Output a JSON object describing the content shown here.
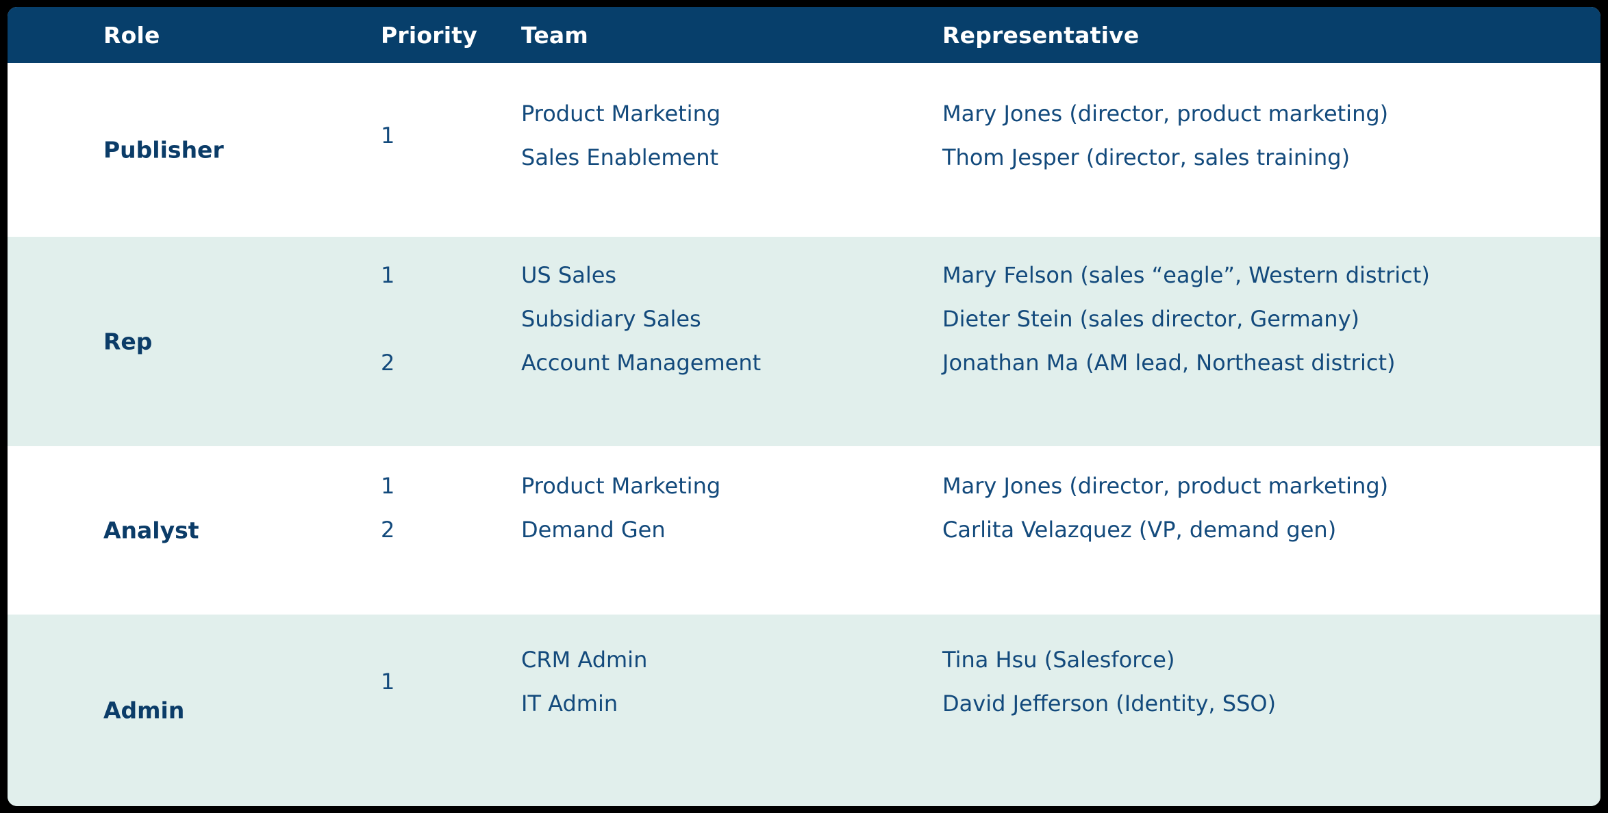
{
  "table": {
    "columns": [
      {
        "key": "role",
        "label": "Role"
      },
      {
        "key": "priority",
        "label": "Priority"
      },
      {
        "key": "team",
        "label": "Team"
      },
      {
        "key": "representative",
        "label": "Representative"
      }
    ],
    "colors": {
      "header_background": "#073f6b",
      "header_text": "#ffffff",
      "row_alt_background": "#e1efec",
      "row_plain_background": "#ffffff",
      "body_text": "#134a7c",
      "role_text": "#0b3c68",
      "page_background": "#000000"
    },
    "sections": [
      {
        "role": "Publisher",
        "shaded": false,
        "rows": [
          {
            "priority": "1",
            "team": "Product Marketing",
            "representative": "Mary Jones (director, product marketing)"
          },
          {
            "priority": "",
            "team": "Sales Enablement",
            "representative": "Thom Jesper (director, sales training)"
          }
        ]
      },
      {
        "role": "Rep",
        "shaded": true,
        "rows": [
          {
            "priority": "1",
            "team": "US Sales",
            "representative": "Mary Felson (sales “eagle”, Western district)"
          },
          {
            "priority": "",
            "team": "Subsidiary Sales",
            "representative": "Dieter Stein (sales director, Germany)"
          },
          {
            "priority": "2",
            "team": "Account Management",
            "representative": "Jonathan Ma (AM lead, Northeast district)"
          }
        ]
      },
      {
        "role": "Analyst",
        "shaded": false,
        "rows": [
          {
            "priority": "1",
            "team": "Product Marketing",
            "representative": "Mary Jones (director, product marketing)"
          },
          {
            "priority": "2",
            "team": "Demand Gen",
            "representative": "Carlita Velazquez (VP, demand gen)"
          }
        ]
      },
      {
        "role": "Admin",
        "shaded": true,
        "rows": [
          {
            "priority": "1",
            "team": "CRM Admin",
            "representative": "Tina Hsu (Salesforce)"
          },
          {
            "priority": "",
            "team": "IT Admin",
            "representative": "David Jefferson (Identity, SSO)"
          }
        ]
      }
    ]
  }
}
